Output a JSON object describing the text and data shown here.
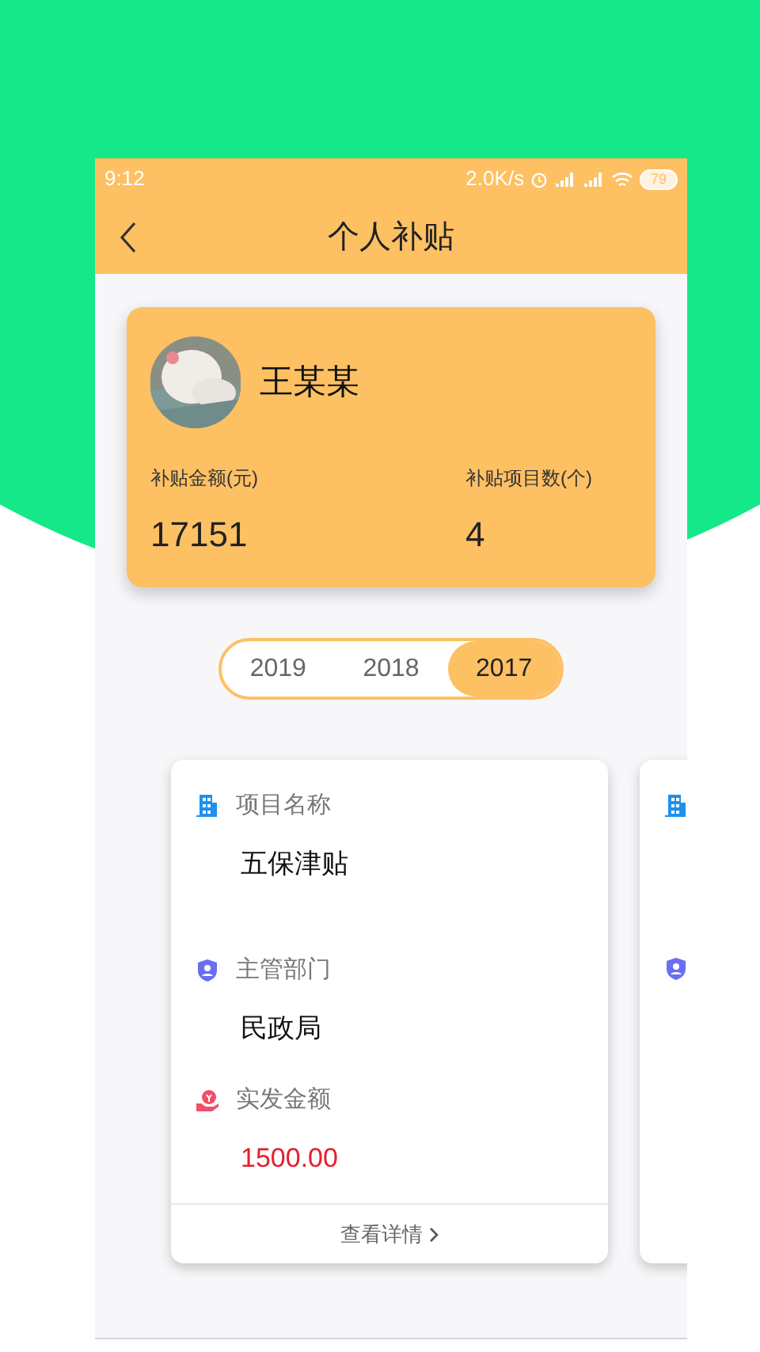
{
  "status_bar": {
    "time": "9:12",
    "speed": "2.0K/s",
    "battery": "79"
  },
  "header": {
    "title": "个人补贴"
  },
  "profile": {
    "name": "王某某",
    "stats": [
      {
        "label": "补贴金额(元)",
        "value": "17151"
      },
      {
        "label": "补贴项目数(个)",
        "value": "4"
      }
    ]
  },
  "years": [
    {
      "label": "2019",
      "selected": false
    },
    {
      "label": "2018",
      "selected": false
    },
    {
      "label": "2017",
      "selected": true
    }
  ],
  "cards": [
    {
      "fields": [
        {
          "kind": "building",
          "label": "项目名称",
          "value": "五保津贴"
        },
        {
          "kind": "shield",
          "label": "主管部门",
          "value": "民政局"
        },
        {
          "kind": "money",
          "label": "实发金额",
          "value": "1500.00"
        }
      ],
      "link": "查看详情"
    }
  ]
}
